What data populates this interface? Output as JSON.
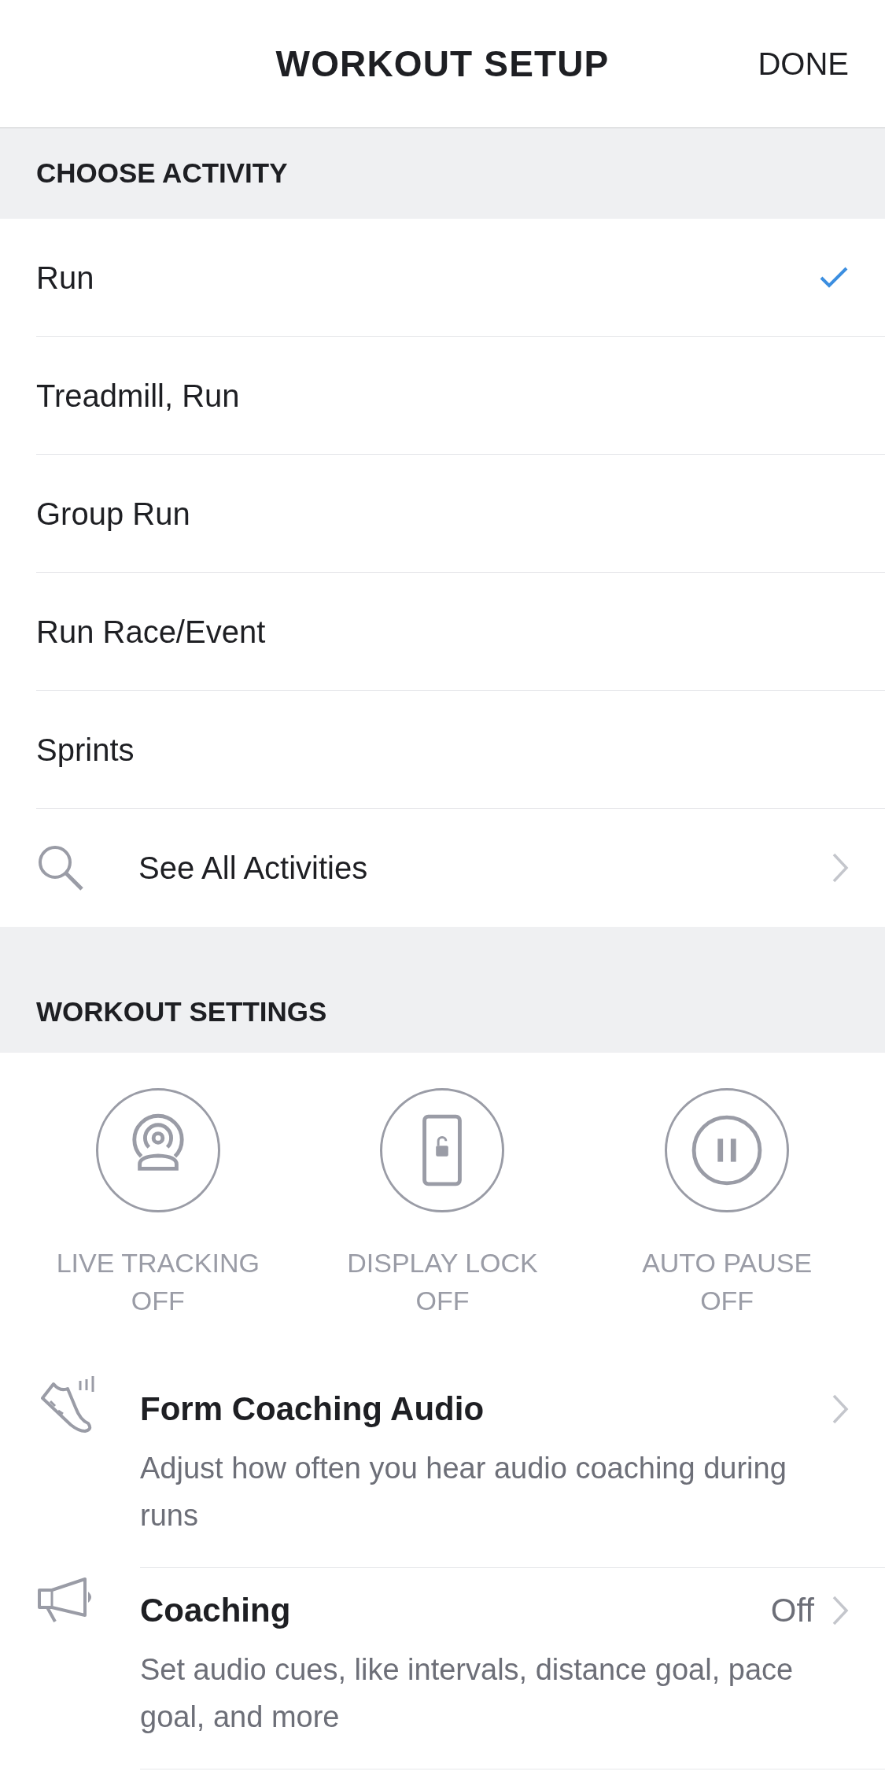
{
  "header": {
    "title": "WORKOUT SETUP",
    "done": "DONE"
  },
  "choose_activity": {
    "heading": "CHOOSE ACTIVITY",
    "items": [
      {
        "label": "Run",
        "selected": true
      },
      {
        "label": "Treadmill, Run",
        "selected": false
      },
      {
        "label": "Group Run",
        "selected": false
      },
      {
        "label": "Run Race/Event",
        "selected": false
      },
      {
        "label": "Sprints",
        "selected": false
      }
    ],
    "see_all": "See All Activities"
  },
  "workout_settings": {
    "heading": "WORKOUT SETTINGS",
    "toggles": [
      {
        "kind": "live",
        "label": "LIVE TRACKING OFF",
        "on": false
      },
      {
        "kind": "lock",
        "label": "DISPLAY LOCK OFF",
        "on": false
      },
      {
        "kind": "pause",
        "label": "AUTO PAUSE OFF",
        "on": false
      }
    ],
    "rows": [
      {
        "kind": "shoe",
        "title": "Form Coaching Audio",
        "description": "Adjust how often you hear audio coaching during runs"
      },
      {
        "kind": "megaphone",
        "title": "Coaching",
        "value": "Off",
        "description": "Set audio cues, like intervals, distance goal, pace goal, and more"
      }
    ]
  }
}
